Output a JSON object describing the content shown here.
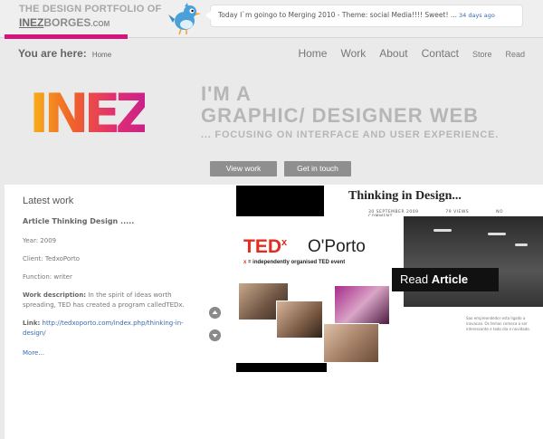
{
  "brand": {
    "tagline": "THE DESIGN PORTFOLIO OF",
    "name_bold": "INEZ",
    "name_rest": "BORGES",
    "name_tld": ".COM"
  },
  "tweet": {
    "text": "Today I`m goingo to Merging 2010 - Theme: social Media!!!! Sweet!",
    "ellipsis": "...",
    "ago": "34 days ago"
  },
  "breadcrumb": {
    "label": "You are here:",
    "current": "Home"
  },
  "nav": {
    "items": [
      "Home",
      "Work",
      "About",
      "Contact",
      "Store",
      "Read"
    ]
  },
  "hero": {
    "logo_text": "INEZ",
    "line1": "I'M A",
    "line2": "GRAPHIC/ DESIGNER WEB",
    "line3": "... FOCUSING ON INTERFACE AND USER EXPERIENCE.",
    "view_work": "View work",
    "get_in_touch": "Get in touch"
  },
  "latest": {
    "heading": "Latest work",
    "title": "Article Thinking Design .....",
    "year_label": "Year:",
    "year": "2009",
    "client_label": "Client:",
    "client": "TedxoPorto",
    "function_label": "Function:",
    "function": "writer",
    "desc_label": "Work description:",
    "desc": "In the spirit of ideas worth spreading, TED has created a program calledTEDx.",
    "link_label": "Link:",
    "link": "http://tedxoporto.com/index.php/thinking-in-design/",
    "more": "More..."
  },
  "thumbnail": {
    "title": "Thinking in Design...",
    "meta": [
      "30 SEPTEMBER 2009",
      "79 VIEWS",
      "NO COMMENT"
    ],
    "tedx": "TED",
    "tedx_sup": "x",
    "oporto": "O'Porto",
    "sub_x": "x",
    "sub_text": " = independently organised TED event",
    "read_normal": "Read ",
    "read_bold": "Article",
    "side_text": "Sao empreendedor esta ligado a inovacao. Os temas comeca a ser interessante e todo dia e novidade."
  },
  "colors": {
    "accent": "#d6137d",
    "link": "#3a6bb3",
    "button": "#8f8f8f"
  }
}
